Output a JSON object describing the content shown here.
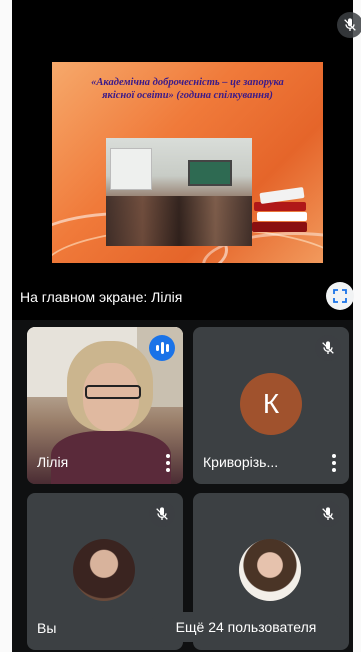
{
  "stage": {
    "slide_title": "«Академічна доброчесність – це запорука якісної освіти» (година спілкування)",
    "label": "На главном экране: Лілія"
  },
  "tiles": [
    {
      "name": "Лілія",
      "state": "speaking"
    },
    {
      "name": "Криворізь...",
      "initial": "К",
      "state": "muted",
      "avatar_color": "#a0522d"
    },
    {
      "name": "Вы",
      "state": "muted"
    },
    {
      "name": "",
      "state": "muted"
    }
  ],
  "more_users": "Ещё 24 пользователя",
  "icons": {
    "muted": "mic-off-icon",
    "speaking": "audio-level-icon",
    "fullscreen": "fullscreen-icon",
    "more": "more-vert-icon"
  },
  "colors": {
    "background": "#0f1011",
    "tile": "#3c4043",
    "speaking": "#1a73e8"
  }
}
